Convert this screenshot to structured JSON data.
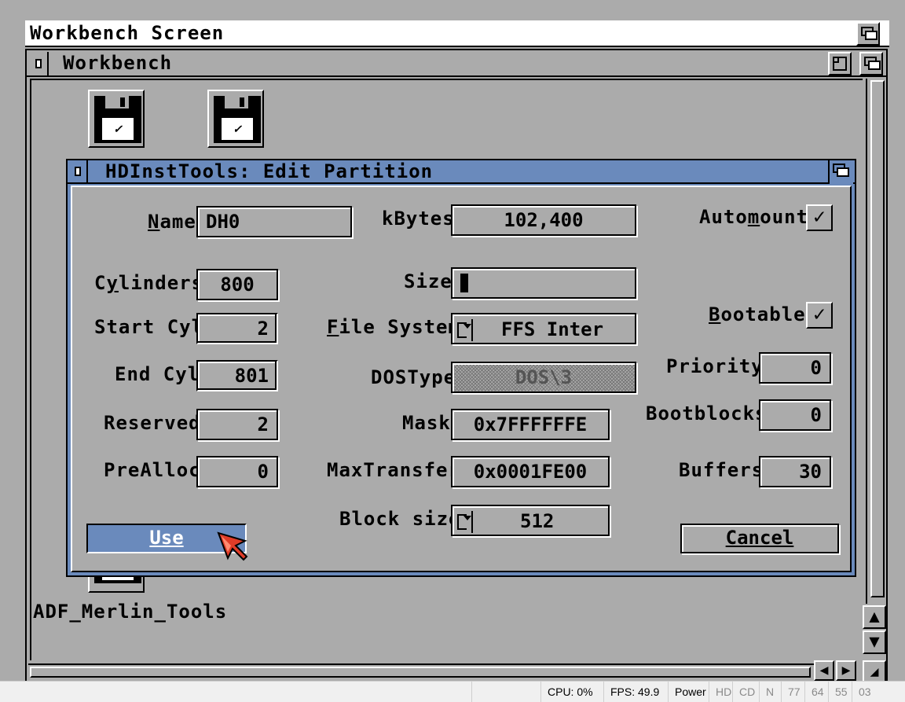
{
  "screen": {
    "title": "Workbench Screen"
  },
  "workbench": {
    "title": "Workbench",
    "icons": [
      {
        "label_text": "✓",
        "name": ""
      },
      {
        "label_text": "✓",
        "name": ""
      },
      {
        "label_text": "✓",
        "name": "ADF_Merlin_Tools"
      }
    ]
  },
  "dialog": {
    "title": "HDInstTools: Edit Partition",
    "fields": {
      "name": {
        "label": "Name",
        "value": "DH0"
      },
      "kbytes": {
        "label": "kBytes",
        "value": "102,400"
      },
      "automount": {
        "label": "Automount",
        "checked_glyph": "✓"
      },
      "cylinders": {
        "label": "Cylinders",
        "value": "800"
      },
      "size": {
        "label": "Size",
        "value": ""
      },
      "bootable": {
        "label": "Bootable",
        "checked_glyph": "✓"
      },
      "start_cyl": {
        "label": "Start Cyl",
        "value": "2"
      },
      "file_system": {
        "label": "File System",
        "value": "FFS Inter"
      },
      "end_cyl": {
        "label": "End Cyl",
        "value": "801"
      },
      "dostype": {
        "label": "DOSType",
        "value": "DOS\\3"
      },
      "priority": {
        "label": "Priority",
        "value": "0"
      },
      "reserved": {
        "label": "Reserved",
        "value": "2"
      },
      "mask": {
        "label": "Mask",
        "value": "0x7FFFFFFE"
      },
      "bootblocks": {
        "label": "Bootblocks",
        "value": "0"
      },
      "prealloc": {
        "label": "PreAlloc",
        "value": "0"
      },
      "maxtransfer": {
        "label": "MaxTransfer",
        "value": "0x0001FE00"
      },
      "buffers": {
        "label": "Buffers",
        "value": "30"
      },
      "block_size": {
        "label": "Block size",
        "value": "512"
      }
    },
    "buttons": {
      "use": "Use",
      "cancel": "Cancel"
    }
  },
  "statusbar": {
    "cpu": "CPU: 0%",
    "fps": "FPS: 49.9",
    "power": "Power",
    "hd": "HD",
    "cd": "CD",
    "n": "N",
    "d0": "77",
    "d1": "64",
    "d2": "55",
    "d3": "03"
  },
  "colors": {
    "background": "#ababab",
    "accent": "#6a8abc",
    "pointer": "#e03c28"
  }
}
